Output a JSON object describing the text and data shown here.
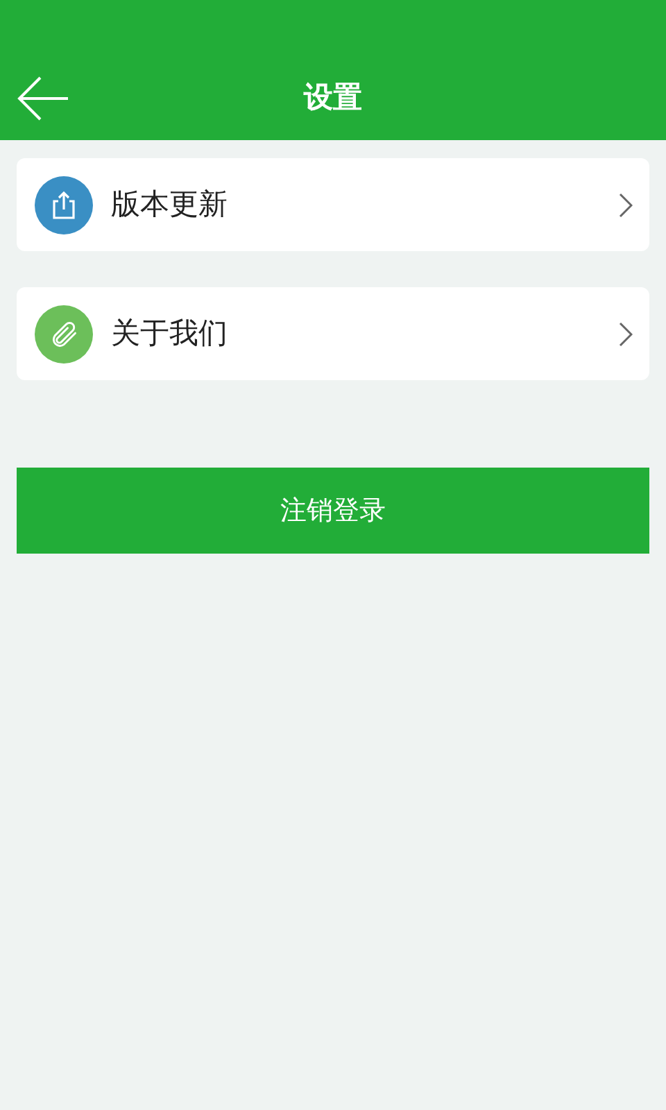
{
  "header": {
    "title": "设置"
  },
  "items": [
    {
      "label": "版本更新",
      "kind": "share",
      "color": "#3a8fc4"
    },
    {
      "label": "关于我们",
      "kind": "clip",
      "color": "#6cbf5a"
    }
  ],
  "logout_button": "注销登录"
}
